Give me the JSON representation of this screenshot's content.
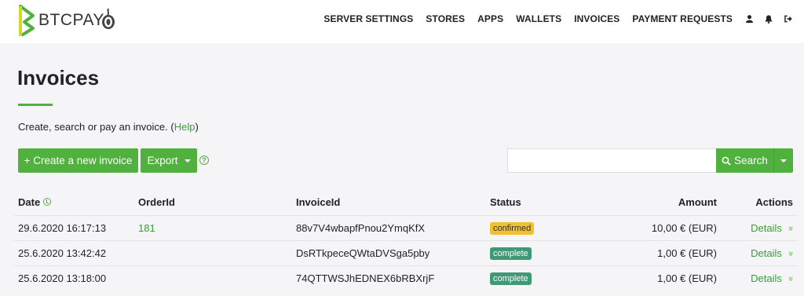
{
  "brand": {
    "name": "BTCPAY",
    "accent": "#51b13e"
  },
  "nav": {
    "items": [
      {
        "label": "SERVER SETTINGS"
      },
      {
        "label": "STORES"
      },
      {
        "label": "APPS"
      },
      {
        "label": "WALLETS"
      },
      {
        "label": "INVOICES"
      },
      {
        "label": "PAYMENT REQUESTS"
      }
    ],
    "icons": [
      "user-icon",
      "bell-icon",
      "logout-icon"
    ]
  },
  "page": {
    "title": "Invoices",
    "description": "Create, search or pay an invoice. (",
    "help_link": "Help",
    "description_end": ")"
  },
  "toolbar": {
    "create_label": "+ Create a new invoice",
    "export_label": "Export",
    "search_placeholder": "",
    "search_label": "Search"
  },
  "table": {
    "headers": {
      "date": "Date",
      "order": "OrderId",
      "invoice": "InvoiceId",
      "status": "Status",
      "amount": "Amount",
      "actions": "Actions"
    },
    "rows": [
      {
        "date": "29.6.2020 16:17:13",
        "order": "181",
        "invoice": "88v7V4wbapfPnou2YmqKfX",
        "status": "confirmed",
        "amount": "10,00 € (EUR)",
        "action": "Details"
      },
      {
        "date": "25.6.2020 13:42:42",
        "order": "",
        "invoice": "DsRTkpeceQWtaDVSga5pby",
        "status": "complete",
        "amount": "1,00 € (EUR)",
        "action": "Details"
      },
      {
        "date": "25.6.2020 13:18:00",
        "order": "",
        "invoice": "74QTTWSJhEDNEX6bRBXrjF",
        "status": "complete",
        "amount": "1,00 € (EUR)",
        "action": "Details"
      }
    ]
  },
  "colors": {
    "confirmed": "#f0c030",
    "complete": "#3e9a74"
  }
}
